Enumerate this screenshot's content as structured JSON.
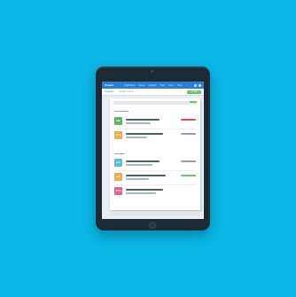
{
  "topbar": {
    "brand": "Project",
    "nav": [
      "Dashboard",
      "Issues",
      "Reports",
      "Team",
      "Docs",
      "Help"
    ]
  },
  "subbar": {
    "tabs": [
      "Projects",
      "Assignments"
    ],
    "new_button": "+ New"
  },
  "rows": [
    {
      "badge": "HB",
      "color": "#5cb85c",
      "status_color": "#e04a4a"
    },
    {
      "badge": "TLS",
      "color": "#f0ad4e",
      "status_color": "#8fa0b0"
    },
    {
      "badge": "AC",
      "color": "#5bc0de",
      "status_color": "#8fa0b0"
    },
    {
      "badge": "AE",
      "color": "#f0ad4e",
      "status_color": "#6cc36b"
    },
    {
      "badge": "TPO",
      "color": "#e8608a",
      "status_color": ""
    }
  ],
  "colors": {
    "background": "#0ab7e6",
    "topbar": "#2a7fd4",
    "accent_green": "#6cc36b"
  }
}
